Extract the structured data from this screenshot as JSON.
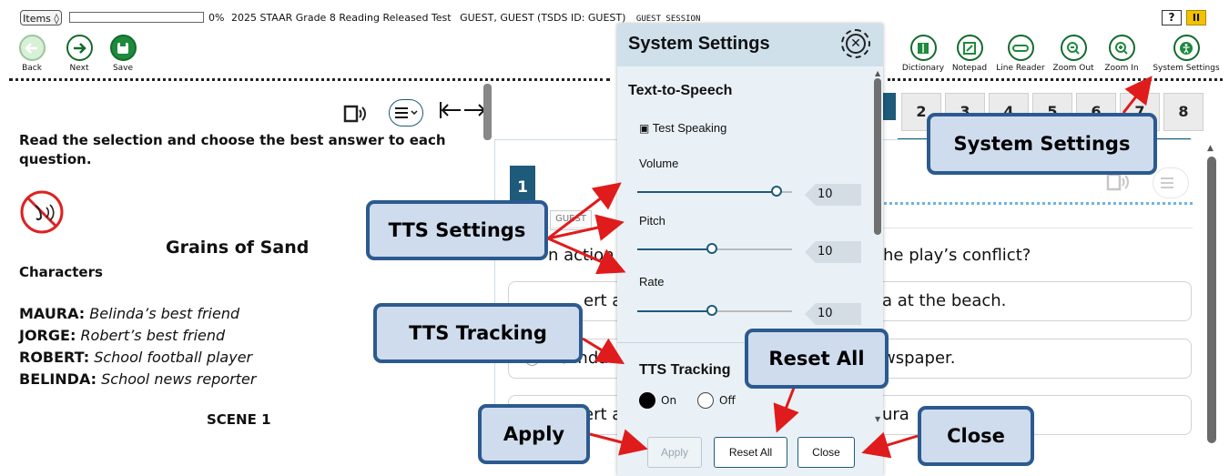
{
  "topbar": {
    "items_label": "Items",
    "progress_text": "0%",
    "test_title": "2025 STAAR Grade 8 Reading Released Test",
    "student": "GUEST, GUEST (TSDS ID: GUEST)",
    "session": "GUEST SESSION",
    "help_label": "?",
    "pause_label": "II"
  },
  "toolbar": {
    "back": "Back",
    "next": "Next",
    "save": "Save",
    "dictionary": "Dictionary",
    "notepad": "Notepad",
    "line_reader": "Line Reader",
    "zoom_out": "Zoom Out",
    "zoom_in": "Zoom In",
    "system_settings": "System Settings"
  },
  "passage": {
    "instructions": "Read the selection and choose the best answer to each question.",
    "title": "Grains of Sand",
    "characters_heading": "Characters",
    "cast": [
      {
        "name": "MAURA:",
        "role": "Belinda’s best friend"
      },
      {
        "name": "JORGE:",
        "role": "Robert’s best friend"
      },
      {
        "name": "ROBERT:",
        "role": "School football player"
      },
      {
        "name": "BELINDA:",
        "role": "School news reporter"
      }
    ],
    "scene": "SCENE 1"
  },
  "question_tabs": [
    "2",
    "3",
    "4",
    "5",
    "6",
    "7",
    "8"
  ],
  "question": {
    "number": "1",
    "guest_tag": "GUEST",
    "stem_start": "n action",
    "stem_end": "he play’s conflict?",
    "options": [
      {
        "left": "ert ar",
        "right": "a at the beach."
      },
      {
        "left": "Belinda v",
        "right": "wspaper."
      },
      {
        "left": "ert ar",
        "right": "ura"
      }
    ]
  },
  "modal": {
    "title": "System Settings",
    "tts_heading": "Text-to-Speech",
    "test_speaking": "Test Speaking",
    "volume_label": "Volume",
    "volume_value": "10",
    "volume_level": 0.9,
    "pitch_label": "Pitch",
    "pitch_value": "10",
    "pitch_level": 0.48,
    "rate_label": "Rate",
    "rate_value": "10",
    "rate_level": 0.48,
    "tracking_heading": "TTS Tracking",
    "on_label": "On",
    "off_label": "Off",
    "apply": "Apply",
    "reset_all": "Reset All",
    "close": "Close"
  },
  "callouts": {
    "system_settings": "System Settings",
    "tts_settings": "TTS Settings",
    "tts_tracking": "TTS Tracking",
    "reset_all": "Reset All",
    "apply": "Apply",
    "close": "Close"
  },
  "colors": {
    "accent": "#1e5a7a",
    "callout_fill": "#cfdcee",
    "callout_border": "#2c5a8f",
    "arrow": "#e01b1b",
    "pause": "#f2c200"
  }
}
